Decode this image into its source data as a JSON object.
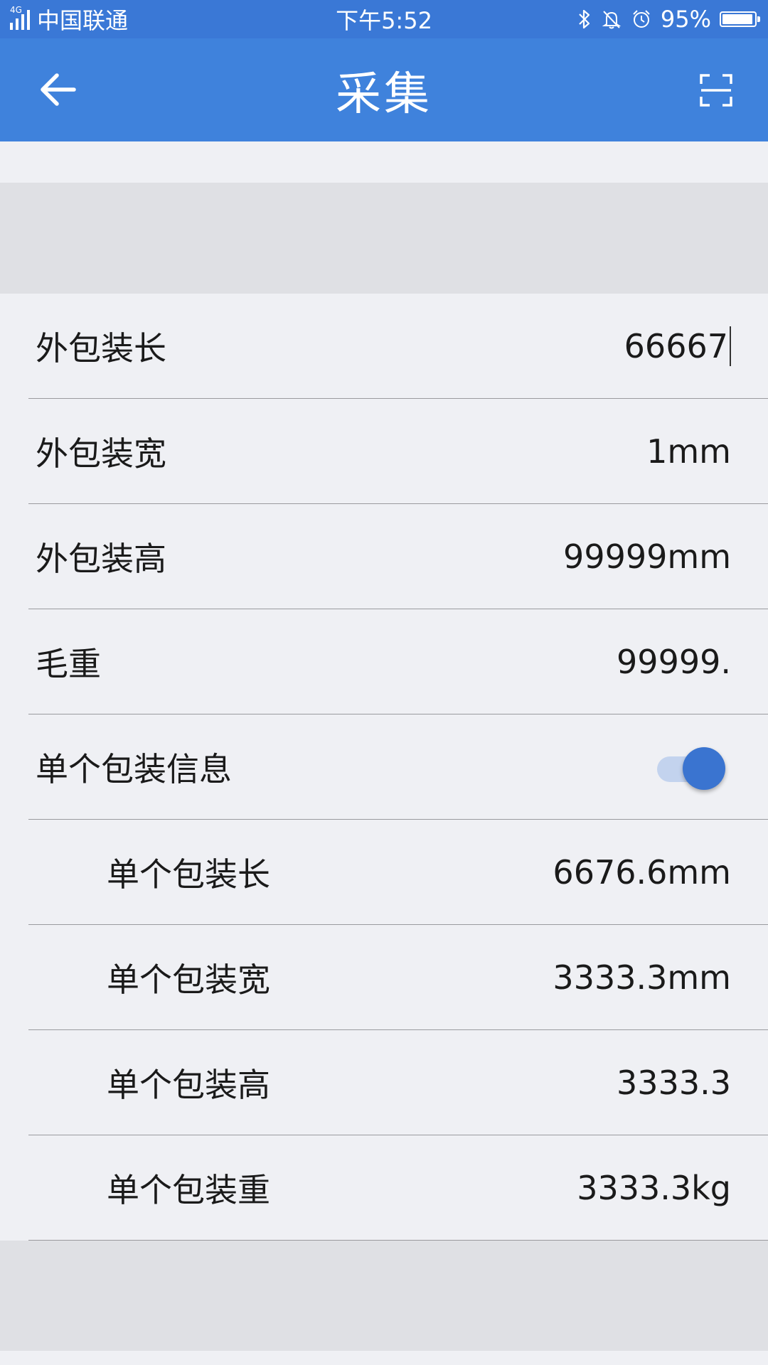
{
  "status_bar": {
    "network_type": "4G",
    "carrier": "中国联通",
    "time": "下午5:52",
    "battery_percent": "95%",
    "battery_level": 0.95,
    "icons": [
      "bluetooth-icon",
      "mute-bell-icon",
      "alarm-icon",
      "battery-icon"
    ]
  },
  "header": {
    "title": "采集",
    "back_icon": "arrow-left-icon",
    "scan_icon": "scan-icon",
    "color": "#3f82dc"
  },
  "outer_package": {
    "length_label": "外包装长",
    "length_value": "66667",
    "width_label": "外包装宽",
    "width_value": "1mm",
    "height_label": "外包装高",
    "height_value": "99999mm",
    "gross_weight_label": "毛重",
    "gross_weight_value": "99999."
  },
  "single_package": {
    "toggle_label": "单个包装信息",
    "toggle_on": true,
    "length_label": "单个包装长",
    "length_value": "6676.6mm",
    "width_label": "单个包装宽",
    "width_value": "3333.3mm",
    "height_label": "单个包装高",
    "height_value": "3333.3",
    "weight_label": "单个包装重",
    "weight_value": "3333.3kg"
  },
  "colors": {
    "accent": "#3f82dc",
    "toggle_knob": "#3a74d0",
    "background": "#eff0f4",
    "section_gap": "#dfe0e4"
  }
}
